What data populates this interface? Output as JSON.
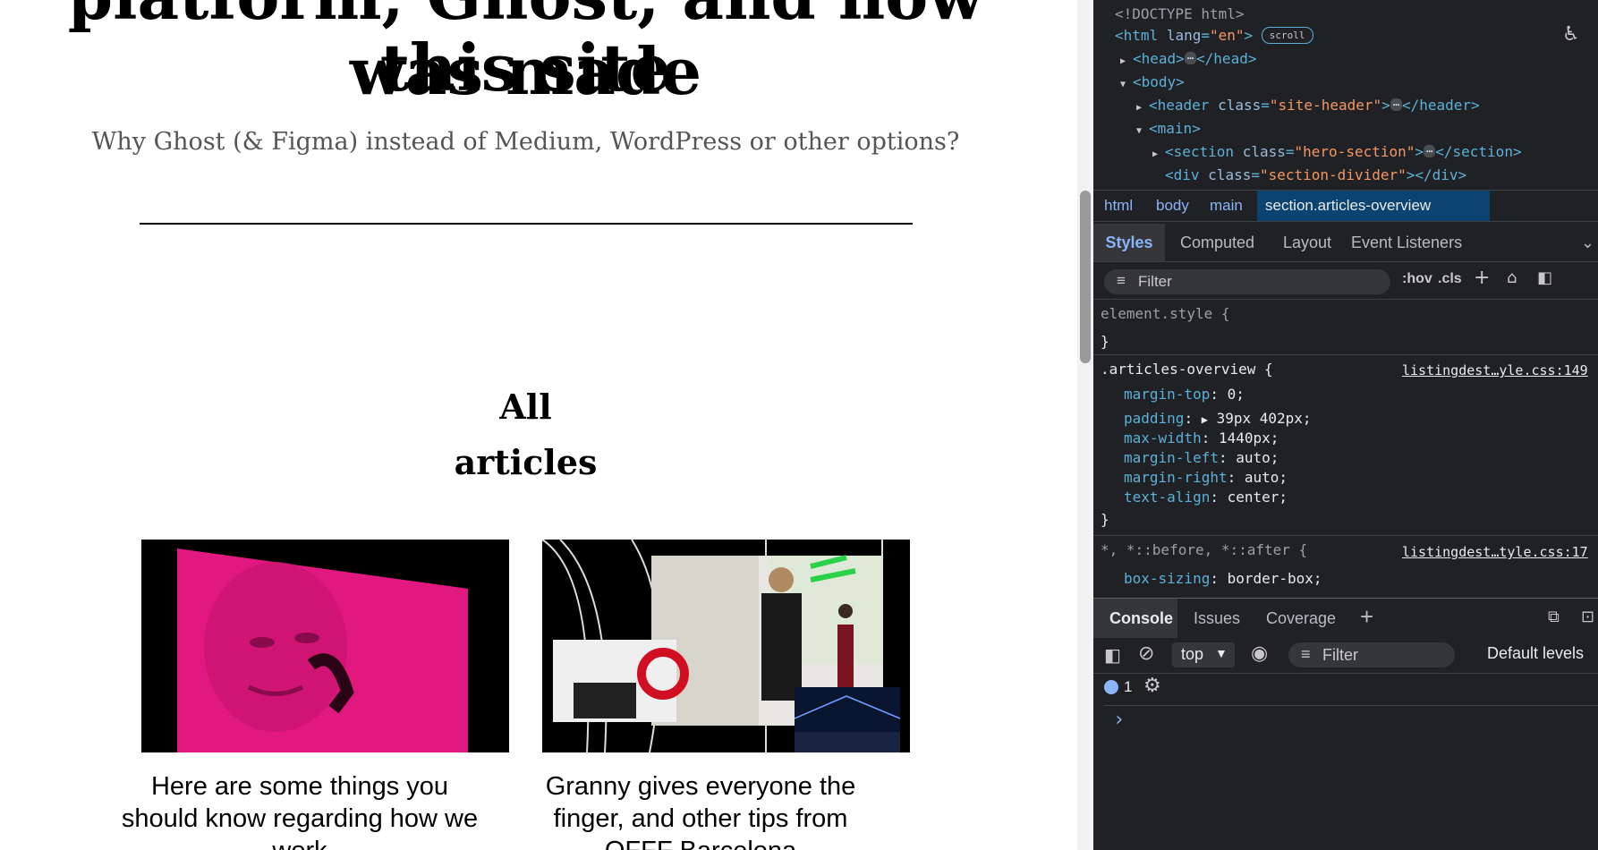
{
  "page": {
    "title_line1": "platform, Ghost, and how this site",
    "title_line2": "was made",
    "subtitle": "Why Ghost (& Figma) instead of Medium, WordPress or other options?",
    "section_heading_line1": "All",
    "section_heading_line2": "articles",
    "cards": [
      {
        "title": "Here are some things you should know regarding how we work"
      },
      {
        "title": "Granny gives everyone the finger, and other tips from OFFF Barcelona"
      }
    ]
  },
  "devtools": {
    "elements": {
      "doctype": "<!DOCTYPE html>",
      "html_tag": "<html",
      "html_attr": "lang",
      "html_val": "\"en\"",
      "scroll_badge": "scroll",
      "head": "<head>",
      "head_close": "</head>",
      "body": "<body>",
      "header_open": "<header",
      "header_attr": "class",
      "header_val": "\"site-header\"",
      "header_close": "</header>",
      "main": "<main>",
      "section_open": "<section",
      "section_attr": "class",
      "section_val": "\"hero-section\"",
      "section_close": "</section>",
      "div_open": "<div",
      "div_attr": "class",
      "div_val": "\"section-divider\"",
      "div_close": "></div>"
    },
    "breadcrumb": [
      "html",
      "body",
      "main",
      "section.articles-overview"
    ],
    "tabs": [
      "Styles",
      "Computed",
      "Layout",
      "Event Listeners"
    ],
    "filter_placeholder": "Filter",
    "filter_actions": [
      ":hov",
      ".cls"
    ],
    "rules": {
      "element_style": "element.style {",
      "close": "}",
      "articles_selector": ".articles-overview {",
      "articles_source": "listingdest…yle.css:149",
      "articles_props": [
        {
          "name": "margin-top",
          "value": "0;"
        },
        {
          "name": "padding",
          "value": "39px 402px;"
        },
        {
          "name": "max-width",
          "value": "1440px;"
        },
        {
          "name": "margin-left",
          "value": "auto;"
        },
        {
          "name": "margin-right",
          "value": "auto;"
        },
        {
          "name": "text-align",
          "value": "center;"
        }
      ],
      "universal_selector": "*, *::before, *::after {",
      "universal_source": "listingdest…tyle.css:17",
      "universal_props": [
        {
          "name": "box-sizing",
          "value": "border-box;"
        }
      ]
    },
    "console": {
      "tabs": [
        "Console",
        "Issues",
        "Coverage"
      ],
      "context": "top",
      "filter": "Filter",
      "levels": "Default levels",
      "message_count": "1",
      "prompt": "›"
    }
  },
  "colors": {
    "devtools_bg": "#202124",
    "accent_blue": "#8ab4f8",
    "tag_color": "#5db0d7",
    "value_color": "#f29766",
    "selected_crumb": "#0b4470"
  }
}
